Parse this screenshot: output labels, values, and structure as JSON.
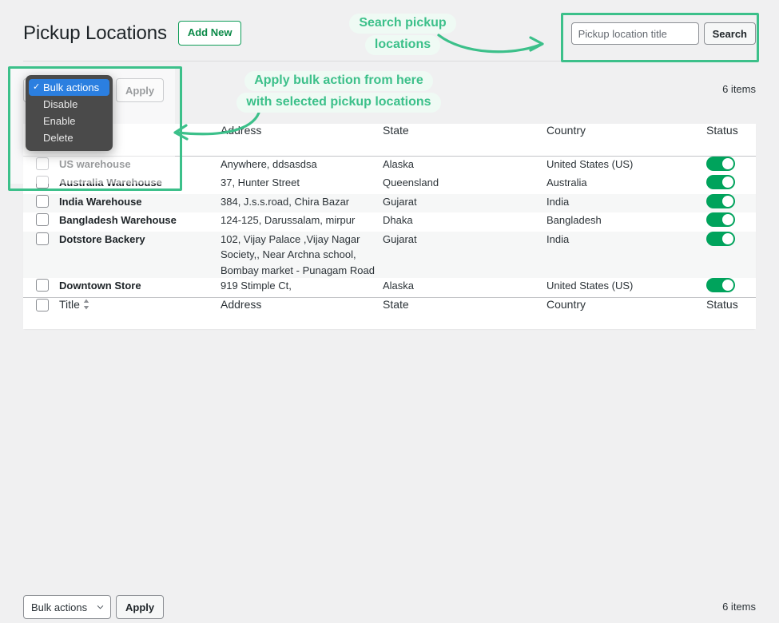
{
  "header": {
    "title": "Pickup Locations",
    "add_new_label": "Add New"
  },
  "search": {
    "placeholder": "Pickup location title",
    "value": "",
    "button_label": "Search"
  },
  "tablenav_top": {
    "bulk_select_value": "Bulk actions",
    "apply_label": "Apply",
    "items_count": "6 items"
  },
  "tablenav_bottom": {
    "bulk_select_value": "Bulk actions",
    "apply_label": "Apply",
    "items_count": "6 items"
  },
  "bulk_dropdown": {
    "open": true,
    "options": [
      "Bulk actions",
      "Disable",
      "Enable",
      "Delete"
    ],
    "selected": "Bulk actions"
  },
  "table": {
    "columns": [
      "Title",
      "Address",
      "State",
      "Country",
      "Status"
    ],
    "rows": [
      {
        "title": "US warehouse",
        "address": "Anywhere, ddsasdsa",
        "state": "Alaska",
        "country": "United States (US)",
        "status": "enabled"
      },
      {
        "title": "Australia Warehouse",
        "address": "37, Hunter Street",
        "state": "Queensland",
        "country": "Australia",
        "status": "enabled"
      },
      {
        "title": "India Warehouse",
        "address": "384, J.s.s.road, Chira Bazar",
        "state": "Gujarat",
        "country": "India",
        "status": "enabled"
      },
      {
        "title": "Bangladesh Warehouse",
        "address": "124-125, Darussalam, mirpur",
        "state": "Dhaka",
        "country": "Bangladesh",
        "status": "enabled"
      },
      {
        "title": "Dotstore Backery",
        "address": "102, Vijay Palace ,Vijay Nagar Society,, Near Archna school, Bombay market - Punagam Road",
        "state": "Gujarat",
        "country": "India",
        "status": "enabled"
      },
      {
        "title": "Downtown Store",
        "address": "919 Stimple Ct,",
        "state": "Alaska",
        "country": "United States (US)",
        "status": "enabled"
      }
    ]
  },
  "annotations": [
    {
      "id": "search",
      "lines": [
        "Search pickup",
        "locations"
      ]
    },
    {
      "id": "bulk",
      "lines": [
        "Apply bulk action from here",
        "with selected pickup locations"
      ]
    }
  ],
  "colors": {
    "accent_green": "#3cc08a",
    "toggle_green": "#00a35c",
    "add_new_green": "#0b8a48",
    "select_highlight_blue": "#2b7fe0",
    "page_background": "#f0f0f1"
  }
}
